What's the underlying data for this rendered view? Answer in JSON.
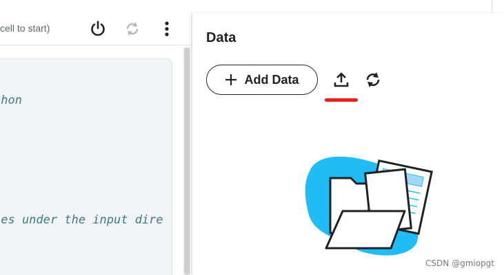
{
  "notebook": {
    "kernel_status": "cell to start)",
    "code_lines": [
      "thon",
      "les under the input dire"
    ]
  },
  "data_panel": {
    "title": "Data",
    "add_data_label": "Add Data",
    "accent_color": "#e8201a",
    "illustration_color": "#20bcf5"
  },
  "watermark": "CSDN @gmiopgt"
}
